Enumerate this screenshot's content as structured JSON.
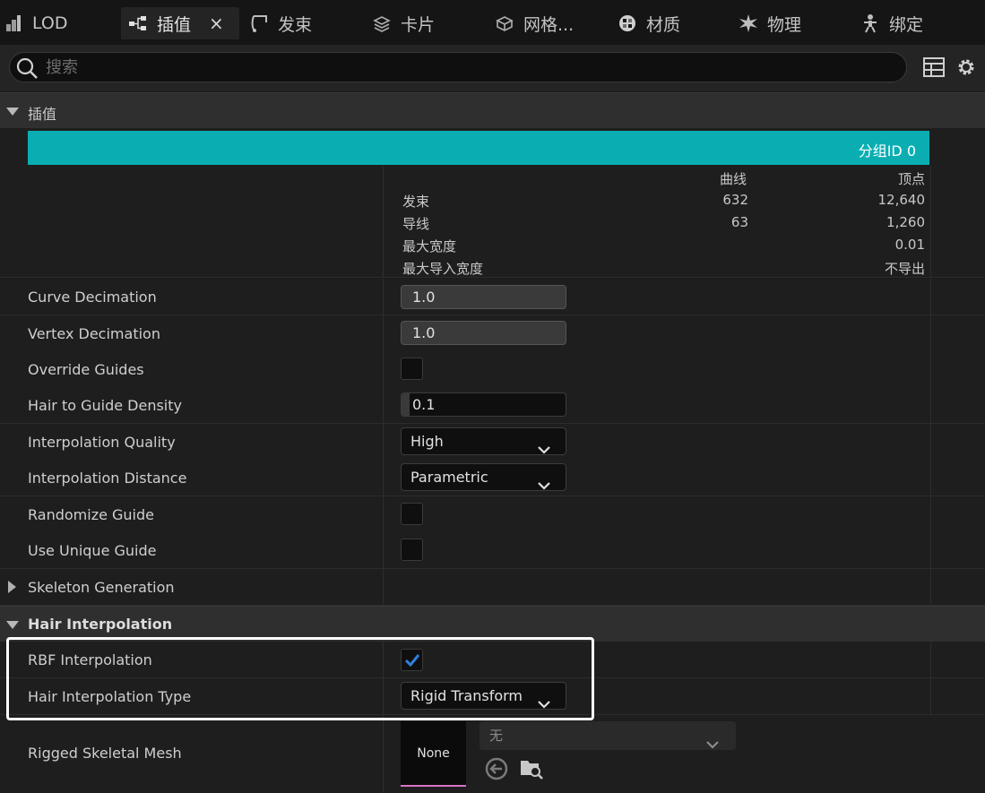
{
  "tabs": [
    {
      "label": "LOD",
      "icon": "lod-icon"
    },
    {
      "label": "插值",
      "icon": "interpolation-icon",
      "active": true
    },
    {
      "label": "发束",
      "icon": "strands-icon"
    },
    {
      "label": "卡片",
      "icon": "cards-icon"
    },
    {
      "label": "网格...",
      "icon": "meshes-icon"
    },
    {
      "label": "材质",
      "icon": "materials-icon"
    },
    {
      "label": "物理",
      "icon": "physics-icon"
    },
    {
      "label": "绑定",
      "icon": "binding-icon"
    }
  ],
  "close_glyph": "×",
  "search": {
    "placeholder": "搜索",
    "value": ""
  },
  "section_interpolation": {
    "title": "插值"
  },
  "group": {
    "label": "分组ID 0"
  },
  "stats": {
    "headers": [
      "曲线",
      "顶点"
    ],
    "rows": [
      {
        "label": "发束",
        "curves": "632",
        "vertices": "12,640"
      },
      {
        "label": "导线",
        "curves": "63",
        "vertices": "1,260"
      },
      {
        "label": "最大宽度",
        "curves": "",
        "vertices": "0.01"
      },
      {
        "label": "最大导入宽度",
        "curves": "",
        "vertices": "不导出"
      }
    ]
  },
  "props": {
    "curve_decimation": {
      "label": "Curve Decimation",
      "value": "1.0"
    },
    "vertex_decimation": {
      "label": "Vertex Decimation",
      "value": "1.0"
    },
    "override_guides": {
      "label": "Override Guides",
      "checked": false
    },
    "hair_to_guide_density": {
      "label": "Hair to Guide Density",
      "value": "0.1"
    },
    "interpolation_quality": {
      "label": "Interpolation Quality",
      "value": "High"
    },
    "interpolation_distance": {
      "label": "Interpolation Distance",
      "value": "Parametric"
    },
    "randomize_guide": {
      "label": "Randomize Guide",
      "checked": false
    },
    "use_unique_guide": {
      "label": "Use Unique Guide",
      "checked": false
    },
    "skeleton_generation": {
      "label": "Skeleton Generation"
    }
  },
  "section_hair_interpolation": {
    "title": "Hair Interpolation"
  },
  "hair_interp": {
    "rbf": {
      "label": "RBF Interpolation",
      "checked": true
    },
    "type": {
      "label": "Hair Interpolation Type",
      "value": "Rigid Transform"
    }
  },
  "rigged_mesh": {
    "label": "Rigged Skeletal Mesh",
    "thumb_label": "None",
    "asset_value": "无"
  },
  "colors": {
    "accent": "#0aaeb2",
    "check": "#2f7fe0",
    "highlight": "#ffffff",
    "mesh_underline": "#d873c6"
  }
}
